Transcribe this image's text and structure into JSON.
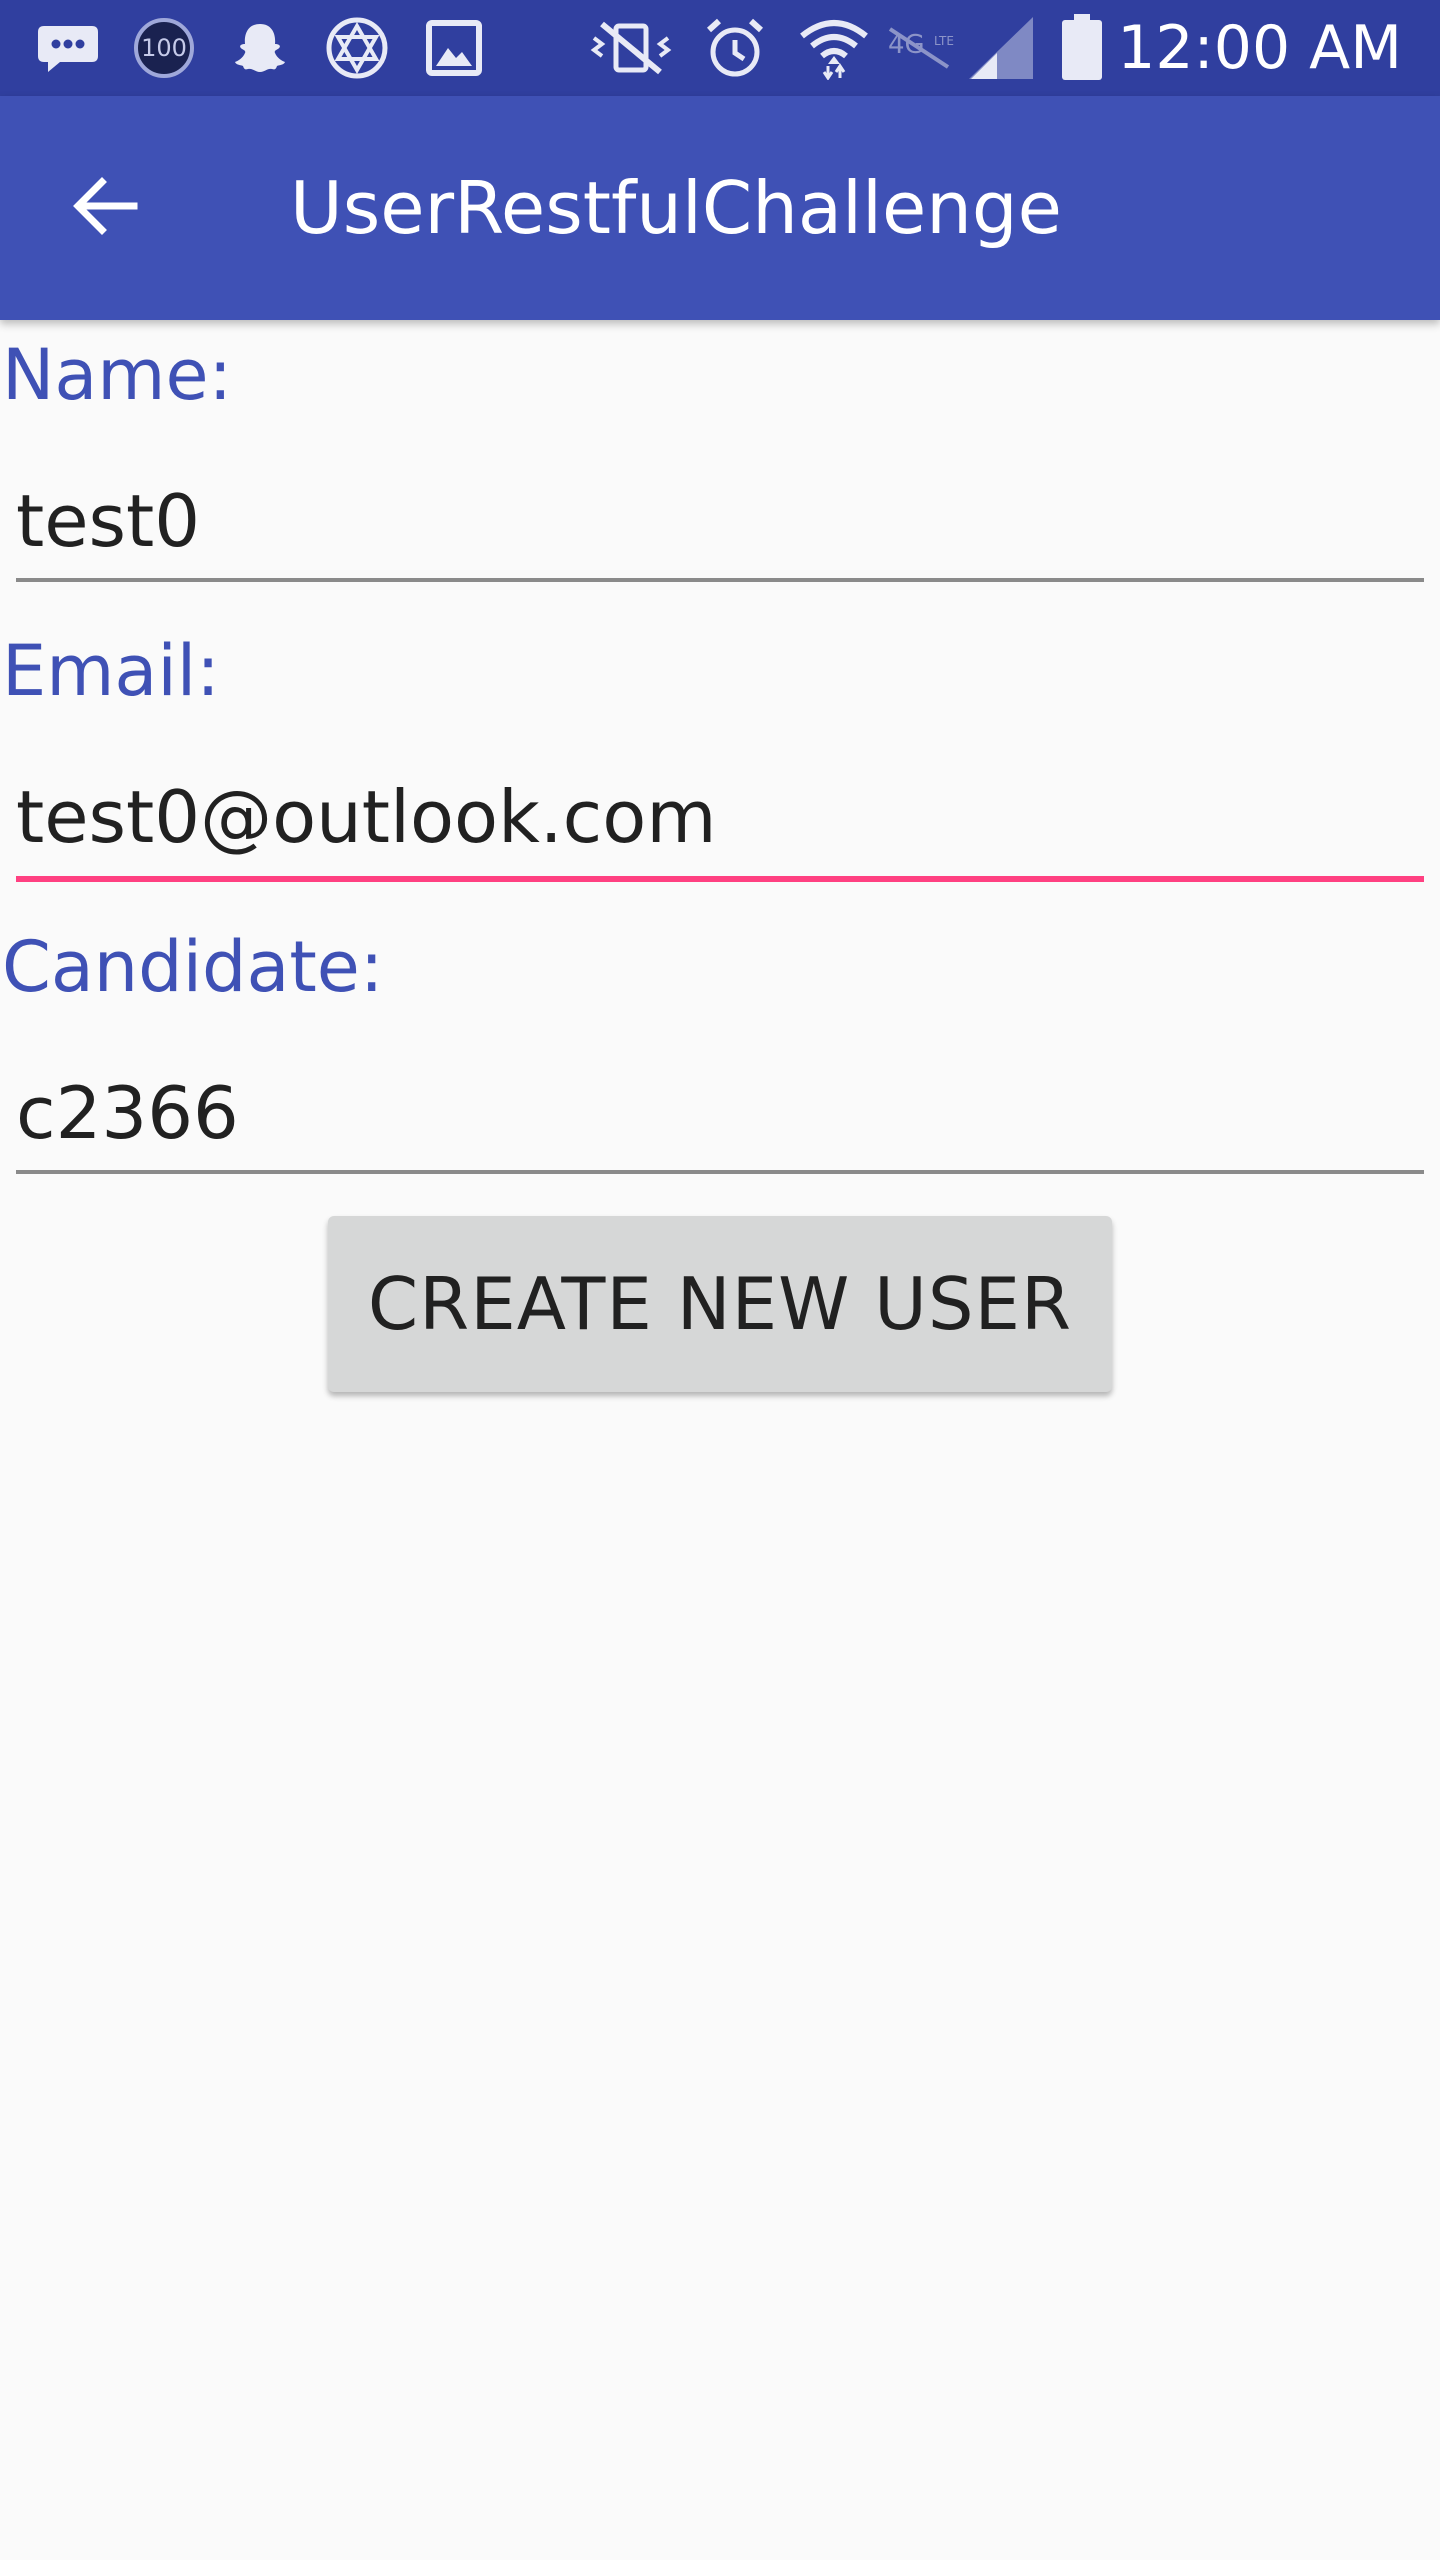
{
  "status_bar": {
    "time": "12:00 AM",
    "badge_number": "100",
    "icons": [
      "chat-bubble-icon",
      "ring-100-icon",
      "snapchat-ghost-icon",
      "star-of-david-icon",
      "image-icon",
      "vibrate-off-icon",
      "alarm-icon",
      "wifi-icon",
      "lte-icon",
      "cell-signal-icon",
      "battery-icon"
    ]
  },
  "app_bar": {
    "title": "UserRestfulChallenge",
    "back_icon": "arrow-left-icon"
  },
  "form": {
    "name_label": "Name:",
    "name_value": "test0",
    "email_label": "Email:",
    "email_value": "test0@outlook.com",
    "candidate_label": "Candidate:",
    "candidate_value": "c2366",
    "submit_label": "CREATE NEW USER"
  },
  "colors": {
    "status_bar": "#303f9f",
    "app_bar": "#3f51b5",
    "label": "#3f51b5",
    "focus_underline": "#ff4081",
    "button": "#d6d7d7"
  }
}
